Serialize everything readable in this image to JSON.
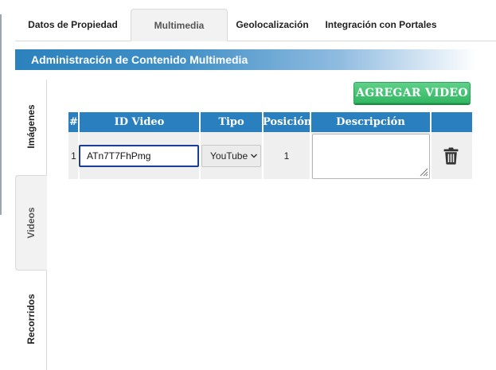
{
  "top_tabs": [
    {
      "label": "Datos de Propiedad"
    },
    {
      "label": "Multimedia"
    },
    {
      "label": "Geolocalización"
    },
    {
      "label": "Integración con Portales"
    }
  ],
  "active_top_tab": "Multimedia",
  "section_title": "Administración de Contenido Multimedia",
  "side_tabs": [
    {
      "label": "Imágenes"
    },
    {
      "label": "Videos"
    },
    {
      "label": "Recorridos"
    }
  ],
  "active_side_tab": "Videos",
  "add_button_label": "AGREGAR VIDEO",
  "table": {
    "headers": [
      "#",
      "ID Video",
      "Tipo",
      "Posición",
      "Descripción",
      ""
    ],
    "rows": [
      {
        "index": "1",
        "id_video": "ATn7T7FhPmg",
        "tipo": "YouTube",
        "posicion": "1",
        "descripcion": ""
      }
    ]
  },
  "icons": {
    "delete": "trash-icon",
    "select": "chevron-down-icon"
  },
  "colors": {
    "banner": "#2c82bd",
    "table_header": "#2a7fbf",
    "add_button": "#33b863",
    "input_focus": "#1a3d9c"
  }
}
